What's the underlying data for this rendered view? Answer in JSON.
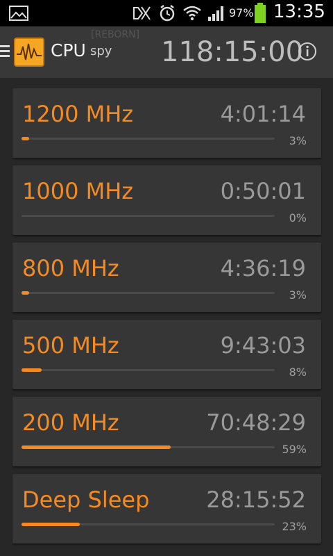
{
  "status_bar": {
    "battery_percent": "97%",
    "time": "13:35",
    "icons": [
      "image-icon",
      "signal-muted-icon",
      "alarm-icon",
      "wifi-icon",
      "cell-signal-icon",
      "battery-charging-icon"
    ]
  },
  "app": {
    "name_primary": "CPU",
    "name_secondary": "spy",
    "badge": "[REBORN]",
    "total_time": "118:15:00"
  },
  "states": [
    {
      "label": "1200 MHz",
      "time": "4:01:14",
      "percent_label": "3%",
      "fraction": 0.03
    },
    {
      "label": "1000 MHz",
      "time": "0:50:01",
      "percent_label": "0%",
      "fraction": 0.0
    },
    {
      "label": "800 MHz",
      "time": "4:36:19",
      "percent_label": "3%",
      "fraction": 0.03
    },
    {
      "label": "500 MHz",
      "time": "9:43:03",
      "percent_label": "8%",
      "fraction": 0.08
    },
    {
      "label": "200 MHz",
      "time": "70:48:29",
      "percent_label": "59%",
      "fraction": 0.59
    },
    {
      "label": "Deep Sleep",
      "time": "28:15:52",
      "percent_label": "23%",
      "fraction": 0.23
    }
  ],
  "colors": {
    "accent": "#f58b20",
    "background": "#272727",
    "card": "#363636",
    "action_bar": "#383838"
  }
}
